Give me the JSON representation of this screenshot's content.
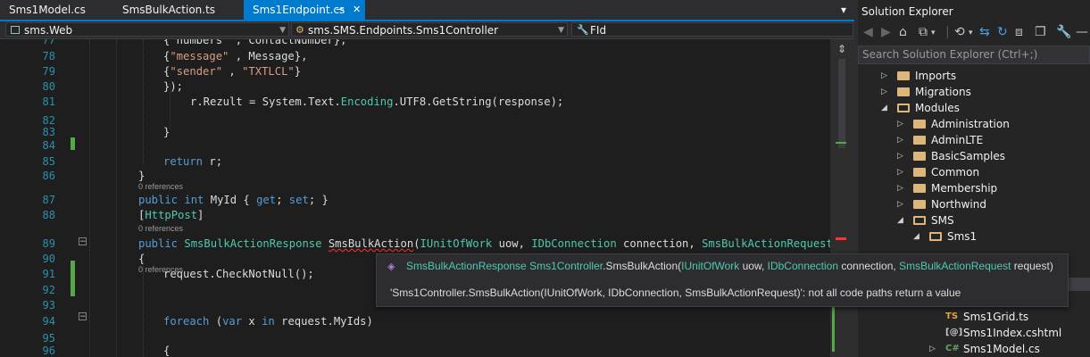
{
  "tabs": [
    {
      "label": "Sms1Model.cs"
    },
    {
      "label": "SmsBulkAction.ts"
    },
    {
      "label": "Sms1Endpoint.cs",
      "pin": "⊸",
      "close": "✕"
    }
  ],
  "tab_overflow": "▾",
  "navbar": {
    "project": "sms.Web",
    "class": "sms.SMS.Endpoints.Sms1Controller",
    "member": "FId"
  },
  "code": {
    "lines": [
      {
        "n": "77",
        "segments": [
          {
            "t": "{\"numbers\" , ContactNumber},",
            "c": ""
          }
        ]
      },
      {
        "n": "78",
        "segments": [
          {
            "t": "{",
            "c": ""
          },
          {
            "t": "\"message\"",
            "c": "st"
          },
          {
            "t": " , Message},",
            "c": ""
          }
        ]
      },
      {
        "n": "79",
        "segments": [
          {
            "t": "{",
            "c": ""
          },
          {
            "t": "\"sender\"",
            "c": "st"
          },
          {
            "t": " , ",
            "c": ""
          },
          {
            "t": "\"TXTLCL\"",
            "c": "st"
          },
          {
            "t": "}",
            "c": ""
          }
        ]
      },
      {
        "n": "80",
        "segments": [
          {
            "t": "});",
            "c": ""
          }
        ]
      },
      {
        "n": "81",
        "segments": [
          {
            "t": "r.Rezult = System.Text.",
            "c": ""
          },
          {
            "t": "Encoding",
            "c": "ty"
          },
          {
            "t": ".UTF8.GetString(response);",
            "c": ""
          }
        ]
      },
      {
        "n": "82",
        "segments": []
      },
      {
        "n": "83",
        "segments": [
          {
            "t": "}",
            "c": ""
          }
        ]
      },
      {
        "n": "84",
        "segments": []
      },
      {
        "n": "85",
        "segments": [
          {
            "t": "return",
            "c": "kw"
          },
          {
            "t": " r;",
            "c": ""
          }
        ]
      },
      {
        "n": "86",
        "segments": [
          {
            "t": "}",
            "c": ""
          }
        ]
      },
      {
        "n": "87",
        "segments": [
          {
            "t": "public",
            "c": "kw"
          },
          {
            "t": " ",
            "c": ""
          },
          {
            "t": "int",
            "c": "kw"
          },
          {
            "t": " MyId { ",
            "c": ""
          },
          {
            "t": "get",
            "c": "kw"
          },
          {
            "t": "; ",
            "c": ""
          },
          {
            "t": "set",
            "c": "kw"
          },
          {
            "t": "; }",
            "c": ""
          }
        ]
      },
      {
        "n": "88",
        "segments": [
          {
            "t": "[",
            "c": ""
          },
          {
            "t": "HttpPost",
            "c": "at"
          },
          {
            "t": "]",
            "c": ""
          }
        ]
      },
      {
        "n": "89",
        "segments": [
          {
            "t": "public",
            "c": "kw"
          },
          {
            "t": " ",
            "c": ""
          },
          {
            "t": "SmsBulkActionResponse",
            "c": "ty"
          },
          {
            "t": " ",
            "c": ""
          },
          {
            "t": "SmsBulkAction",
            "c": "squig"
          },
          {
            "t": "(",
            "c": ""
          },
          {
            "t": "IUnitOfWork",
            "c": "ty"
          },
          {
            "t": " uow, ",
            "c": ""
          },
          {
            "t": "IDbConnection",
            "c": "ty"
          },
          {
            "t": " connection, ",
            "c": ""
          },
          {
            "t": "SmsBulkActionRequest",
            "c": "ty"
          },
          {
            "t": " rec",
            "c": ""
          }
        ]
      },
      {
        "n": "90",
        "segments": [
          {
            "t": "{",
            "c": ""
          }
        ]
      },
      {
        "n": "91",
        "segments": [
          {
            "t": "request.CheckNotNull();",
            "c": ""
          }
        ]
      },
      {
        "n": "92",
        "segments": []
      },
      {
        "n": "93",
        "segments": []
      },
      {
        "n": "94",
        "segments": [
          {
            "t": "foreach",
            "c": "kw"
          },
          {
            "t": " (",
            "c": ""
          },
          {
            "t": "var",
            "c": "kw"
          },
          {
            "t": " x ",
            "c": ""
          },
          {
            "t": "in",
            "c": "kw"
          },
          {
            "t": " request.MyIds)",
            "c": ""
          }
        ]
      },
      {
        "n": "95",
        "segments": []
      },
      {
        "n": "96",
        "segments": [
          {
            "t": "{",
            "c": ""
          }
        ]
      }
    ],
    "references_label": "0 references"
  },
  "tooltip": {
    "signature": [
      {
        "t": "SmsBulkActionResponse",
        "c": "ty"
      },
      {
        "t": " ",
        "c": ""
      },
      {
        "t": "Sms1Controller",
        "c": "ty"
      },
      {
        "t": ".SmsBulkAction(",
        "c": ""
      },
      {
        "t": "IUnitOfWork",
        "c": "ty"
      },
      {
        "t": " uow, ",
        "c": ""
      },
      {
        "t": "IDbConnection",
        "c": "ty"
      },
      {
        "t": " connection, ",
        "c": ""
      },
      {
        "t": "SmsBulkActionRequest",
        "c": "ty"
      },
      {
        "t": " request)",
        "c": ""
      }
    ],
    "error": "'Sms1Controller.SmsBulkAction(IUnitOfWork, IDbConnection, SmsBulkActionRequest)': not all code paths return a value"
  },
  "solution_explorer": {
    "title": "Solution Explorer",
    "search_placeholder": "Search Solution Explorer (Ctrl+;)",
    "items": [
      {
        "label": "Imports",
        "kind": "folder",
        "expanded": false
      },
      {
        "label": "Migrations",
        "kind": "folder",
        "expanded": false
      },
      {
        "label": "Modules",
        "kind": "folder",
        "expanded": true
      },
      {
        "label": "Administration",
        "kind": "folder",
        "expanded": false
      },
      {
        "label": "AdminLTE",
        "kind": "folder",
        "expanded": false
      },
      {
        "label": "BasicSamples",
        "kind": "folder",
        "expanded": false
      },
      {
        "label": "Common",
        "kind": "folder",
        "expanded": false
      },
      {
        "label": "Membership",
        "kind": "folder",
        "expanded": false
      },
      {
        "label": "Northwind",
        "kind": "folder",
        "expanded": false
      },
      {
        "label": "SMS",
        "kind": "folder",
        "expanded": true
      },
      {
        "label": "Sms1",
        "kind": "folder",
        "expanded": true
      },
      {
        "label": "Sms1Grid.ts",
        "kind": "ts"
      },
      {
        "label": "Sms1Index.cshtml",
        "kind": "cshtml"
      },
      {
        "label": "Sms1Model.cs",
        "kind": "cs"
      }
    ],
    "file_badges": {
      "ts": "TS",
      "cshtml": "[@]",
      "cs": "C#"
    }
  },
  "colors": {
    "accent": "#007acc",
    "keyword": "#569cd6",
    "type": "#4ec9b0",
    "string": "#d69d85",
    "line_number": "#2b91af",
    "change_bar": "#57a64a"
  }
}
